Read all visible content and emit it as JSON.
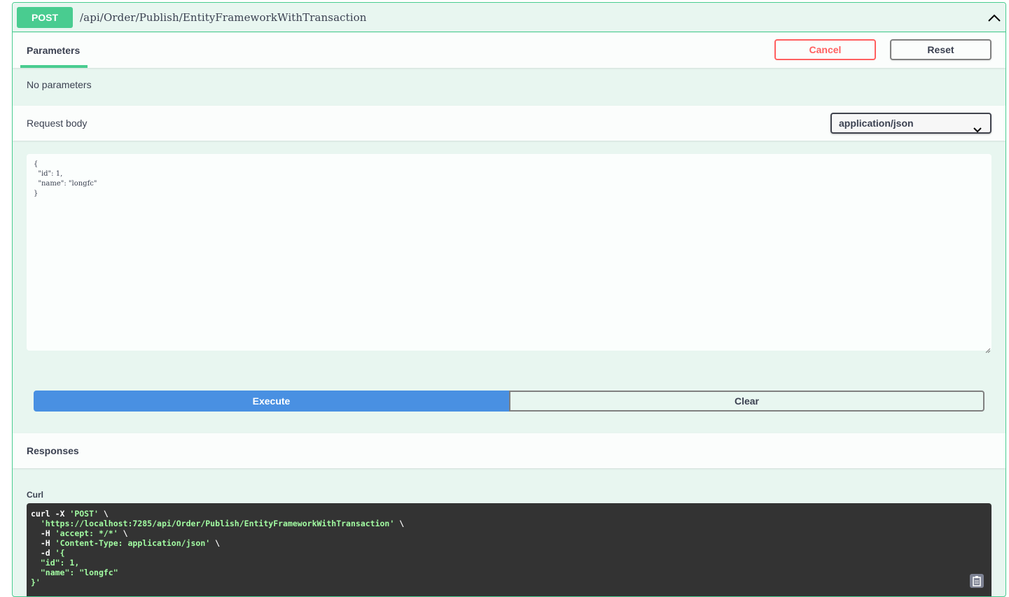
{
  "summary": {
    "method": "POST",
    "path": "/api/Order/Publish/EntityFrameworkWithTransaction"
  },
  "parameters": {
    "tab_label": "Parameters",
    "cancel_label": "Cancel",
    "reset_label": "Reset",
    "empty_text": "No parameters"
  },
  "request_body": {
    "label": "Request body",
    "content_type": "application/json",
    "value": "{\n  \"id\": 1,\n  \"name\": \"longfc\"\n}"
  },
  "actions": {
    "execute_label": "Execute",
    "clear_label": "Clear"
  },
  "responses": {
    "title": "Responses",
    "curl_label": "Curl",
    "curl": {
      "cmd_prefix": "curl -X ",
      "method": "'POST'",
      "line1_end": " \\",
      "url": "'https://localhost:7285/api/Order/Publish/EntityFrameworkWithTransaction'",
      "header_flag": "-H ",
      "accept": "'accept: */*'",
      "content_type": "'Content-Type: application/json'",
      "data_flag": "-d ",
      "data_open": "'{",
      "data_id": "\"id\": 1,",
      "data_name": "\"name\": \"longfc\"",
      "data_close": "}'"
    }
  },
  "colors": {
    "post": "#49cc90",
    "execute": "#4990e2",
    "cancel": "#ff6060"
  }
}
